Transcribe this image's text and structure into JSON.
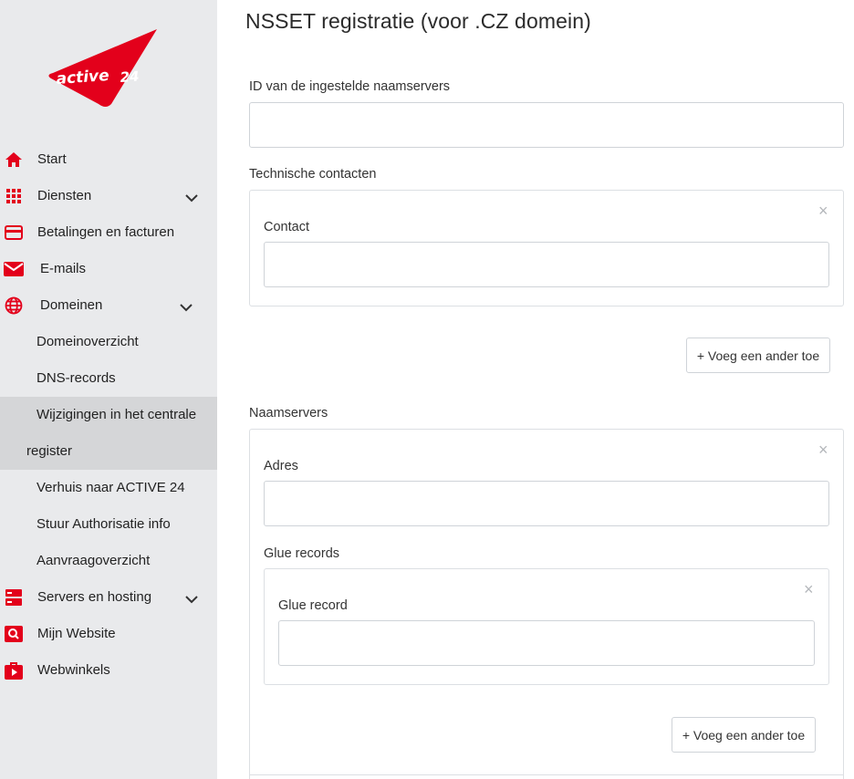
{
  "logo": {
    "text": "active 24",
    "color": "#e3001b"
  },
  "nav": {
    "items": [
      {
        "label": "Start",
        "icon": "home-icon"
      },
      {
        "label": "Diensten",
        "icon": "grid-icon",
        "expandable": true
      },
      {
        "label": "Betalingen en facturen",
        "icon": "credit-card-icon"
      },
      {
        "label": "E-mails",
        "icon": "mail-icon"
      },
      {
        "label": "Domeinen",
        "icon": "globe-icon",
        "expandable": true,
        "expanded": true
      },
      {
        "label": "Servers en hosting",
        "icon": "server-icon",
        "expandable": true
      },
      {
        "label": "Mijn Website",
        "icon": "website-search-icon"
      },
      {
        "label": "Webwinkels",
        "icon": "shop-bag-icon"
      }
    ],
    "domain_sub": [
      {
        "label": "Domeinoverzicht"
      },
      {
        "label": "DNS-records"
      },
      {
        "label_line1": "Wijzigingen in het centrale",
        "label_line2": "register",
        "active": true
      },
      {
        "label": "Verhuis naar ACTIVE 24"
      },
      {
        "label": "Stuur Authorisatie info"
      },
      {
        "label": "Aanvraagoverzicht"
      }
    ]
  },
  "main": {
    "title": "NSSET registratie (voor .CZ domein)",
    "nsset_id": {
      "label": "ID van de ingestelde naamservers",
      "value": ""
    },
    "tech_contacts": {
      "label": "Technische contacten",
      "contact": {
        "label": "Contact",
        "value": ""
      },
      "remove": "×",
      "add_button": "+ Voeg een ander toe"
    },
    "nameservers": {
      "label": "Naamservers",
      "remove": "×",
      "address": {
        "label": "Adres",
        "value": ""
      },
      "glue_records": {
        "label": "Glue records",
        "remove": "×",
        "glue_record": {
          "label": "Glue record",
          "value": ""
        },
        "add_button": "+ Voeg een ander toe"
      }
    }
  },
  "colors": {
    "accent": "#e3001b",
    "sidebar_bg": "#e9eaec",
    "active_bg": "#d5d6d8"
  }
}
